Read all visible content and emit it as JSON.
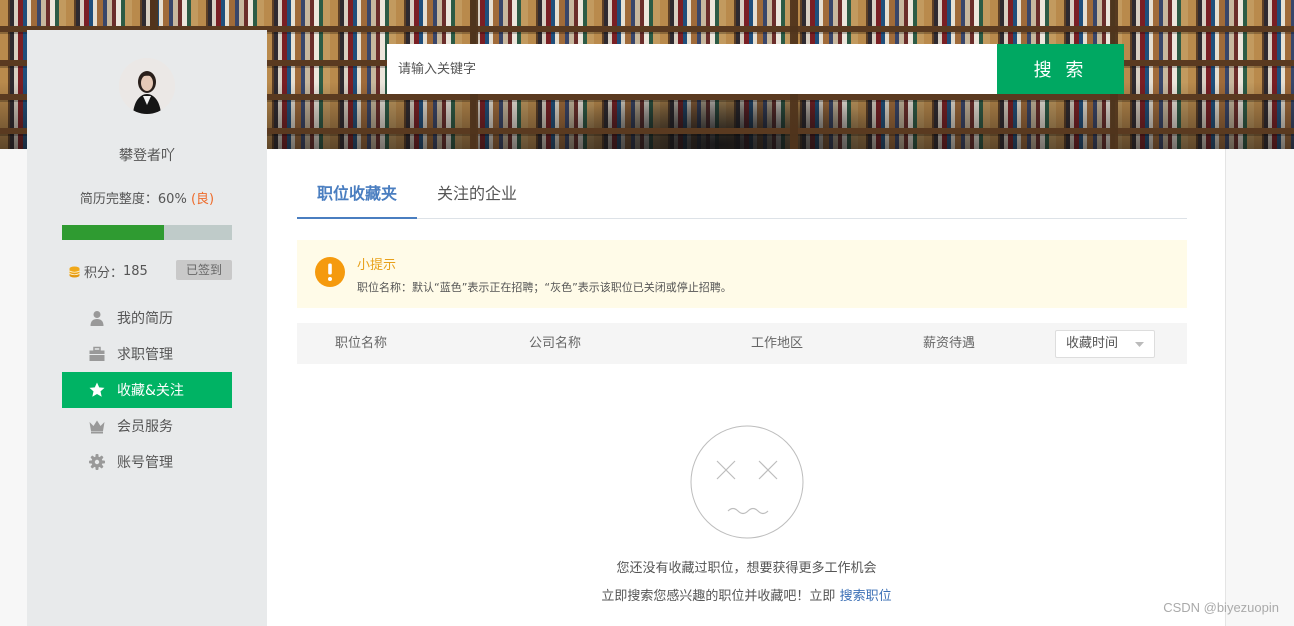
{
  "search": {
    "placeholder": "请输入关键字",
    "button_label": "搜 索"
  },
  "profile": {
    "username": "攀登者吖",
    "completeness_label": "简历完整度：",
    "completeness_value": "60%",
    "completeness_grade": "(良)",
    "completeness_fraction": 0.6,
    "points_label": "积分：",
    "points_value": "185",
    "checked_in_label": "已签到"
  },
  "sidebar": {
    "items": [
      {
        "label": "我的简历",
        "icon": "user-icon"
      },
      {
        "label": "求职管理",
        "icon": "briefcase-icon"
      },
      {
        "label": "收藏&关注",
        "icon": "star-icon",
        "active": true
      },
      {
        "label": "会员服务",
        "icon": "crown-icon"
      },
      {
        "label": "账号管理",
        "icon": "gear-icon"
      }
    ]
  },
  "tabs": [
    {
      "label": "职位收藏夹",
      "active": true
    },
    {
      "label": "关注的企业"
    }
  ],
  "tip": {
    "icon": "exclamation-icon",
    "title": "小提示",
    "text": "职位名称：默认“蓝色”表示正在招聘；“灰色”表示该职位已关闭或停止招聘。"
  },
  "table": {
    "columns": [
      "职位名称",
      "公司名称",
      "工作地区",
      "薪资待遇"
    ],
    "sort_selected": "收藏时间"
  },
  "empty_state": {
    "icon": "sad-face-icon",
    "line1": "您还没有收藏过职位，想要获得更多工作机会",
    "line2_prefix": "立即搜索您感兴趣的职位并收藏吧！立即 ",
    "link_label": "搜索职位"
  },
  "watermark": "CSDN @biyezuopin",
  "colors": {
    "accent_green": "#00a862",
    "active_blue": "#4a7ec0",
    "grade_orange": "#ee6c2c",
    "tip_orange": "#e8a01a"
  }
}
